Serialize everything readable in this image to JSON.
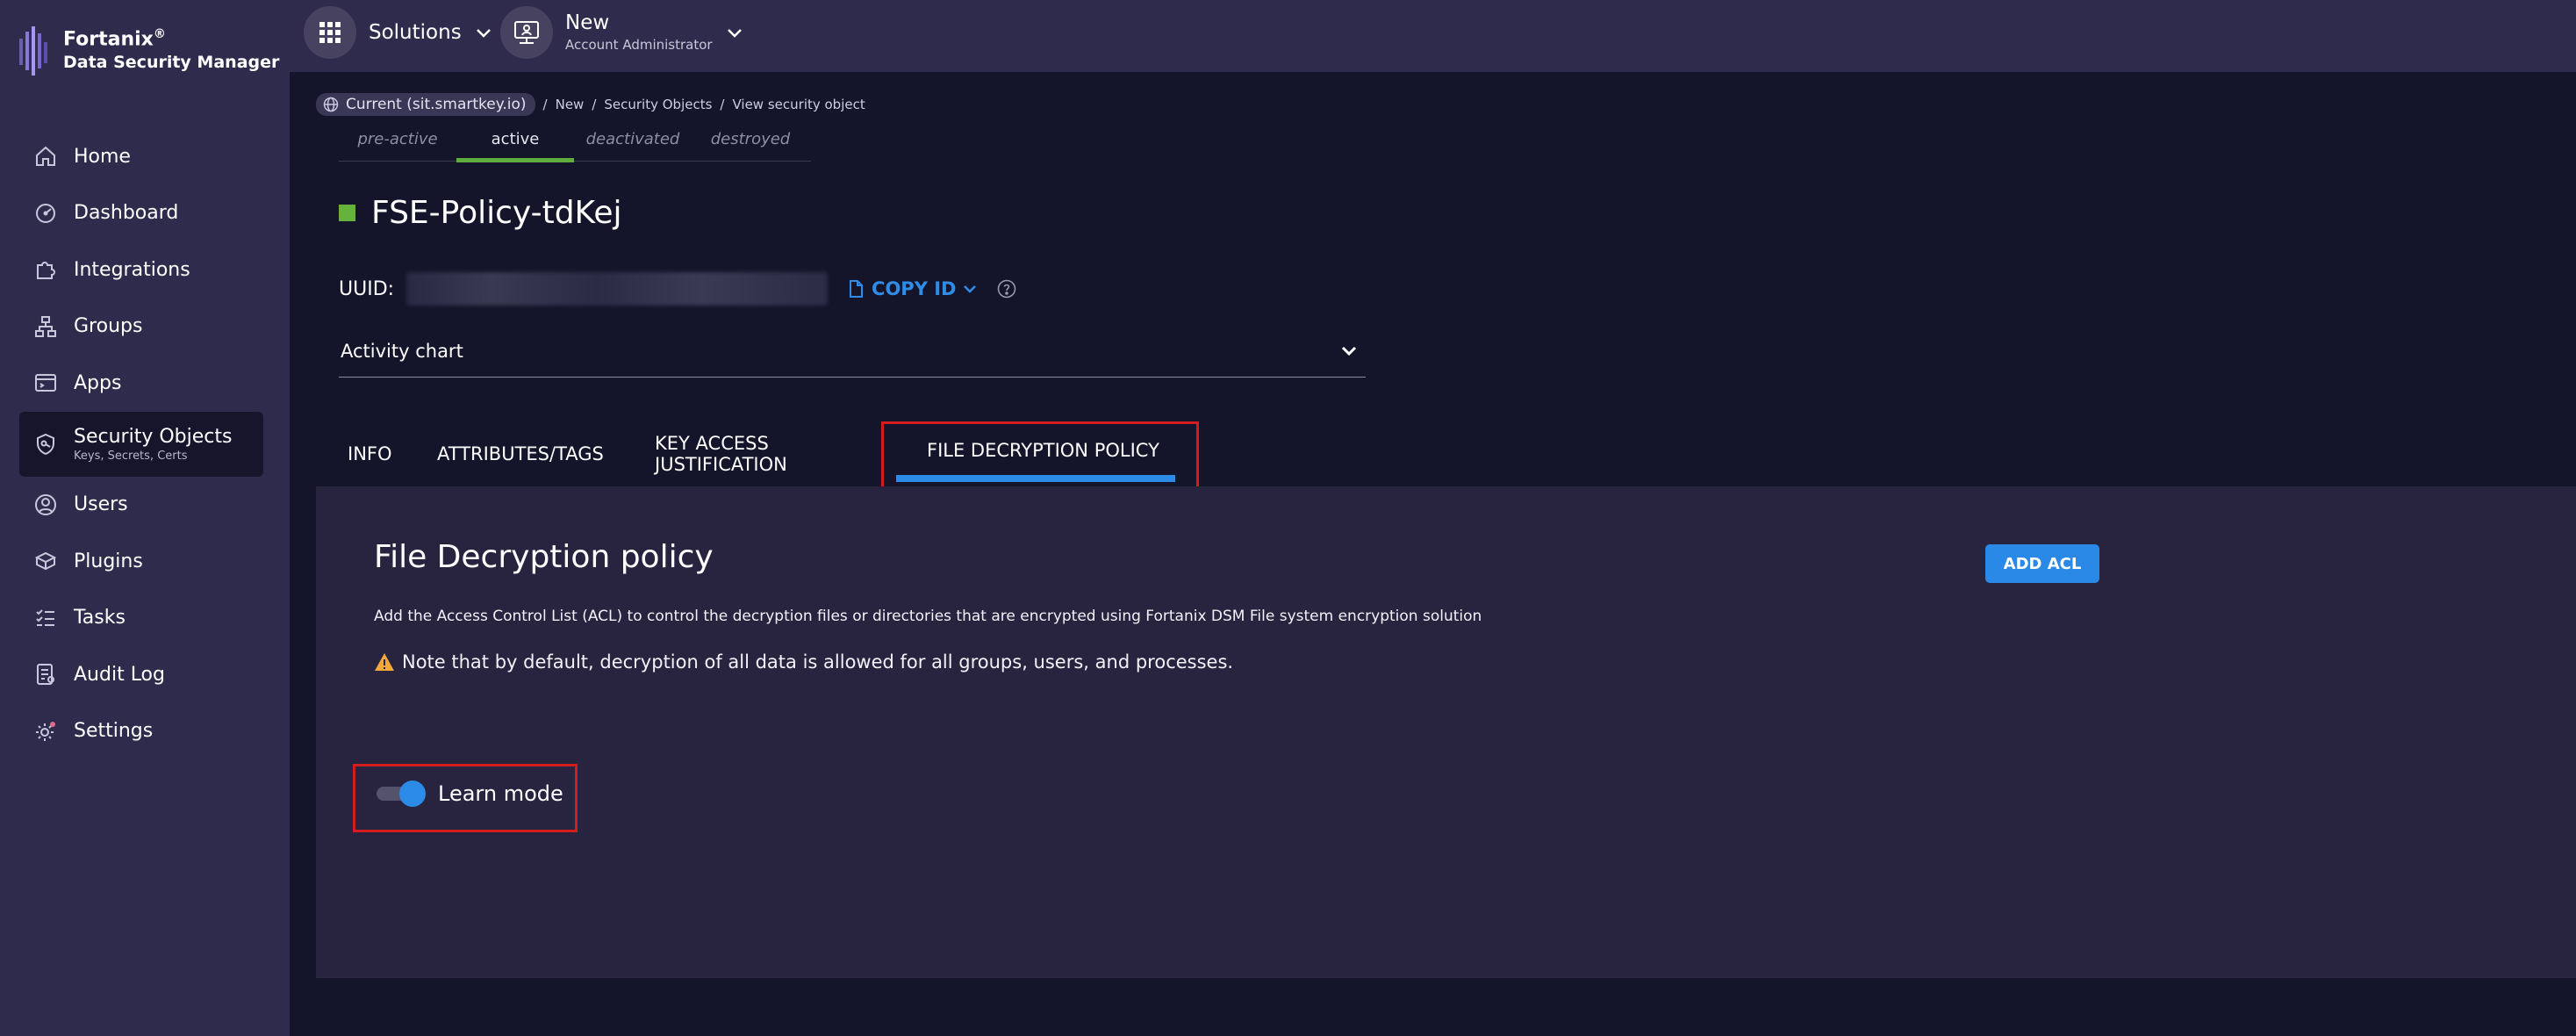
{
  "brand": {
    "name": "Fortanix",
    "registered": "®",
    "product": "Data Security Manager"
  },
  "nav": {
    "items": [
      {
        "label": "Home",
        "icon": "home-icon"
      },
      {
        "label": "Dashboard",
        "icon": "dashboard-icon"
      },
      {
        "label": "Integrations",
        "icon": "puzzle-icon"
      },
      {
        "label": "Groups",
        "icon": "groups-icon"
      },
      {
        "label": "Apps",
        "icon": "apps-icon"
      },
      {
        "label": "Security Objects",
        "sub": "Keys, Secrets, Certs",
        "icon": "shield-key-icon",
        "active": true
      },
      {
        "label": "Users",
        "icon": "user-icon"
      },
      {
        "label": "Plugins",
        "icon": "plugin-icon"
      },
      {
        "label": "Tasks",
        "icon": "tasks-icon"
      },
      {
        "label": "Audit Log",
        "icon": "audit-log-icon"
      },
      {
        "label": "Settings",
        "icon": "gear-icon"
      }
    ]
  },
  "topbar": {
    "solutions_label": "Solutions",
    "account_name": "New",
    "account_role": "Account Administrator"
  },
  "breadcrumb": {
    "current": "Current (sit.smartkey.io)",
    "items": [
      "New",
      "Security Objects",
      "View security object"
    ],
    "separator": "/"
  },
  "states": {
    "items": [
      "pre-active",
      "active",
      "deactivated",
      "destroyed"
    ],
    "active": "active"
  },
  "object": {
    "title": "FSE-Policy-tdKej",
    "status_color": "#65b33d",
    "uuid_label": "UUID:",
    "uuid_value": "••••••••-••••-••••-••••-••••••••••••",
    "copy_label": "COPY ID"
  },
  "activity": {
    "label": "Activity chart"
  },
  "tabs": {
    "items": [
      "INFO",
      "ATTRIBUTES/TAGS",
      "KEY ACCESS JUSTIFICATION",
      "FILE DECRYPTION POLICY"
    ],
    "active": "FILE DECRYPTION POLICY"
  },
  "panel": {
    "title": "File Decryption policy",
    "add_acl_label": "ADD ACL",
    "description": "Add the Access Control List (ACL) to control the decryption files or directories that are encrypted using Fortanix DSM File system encryption solution",
    "note": "Note that by default, decryption of all data is allowed for all groups, users, and processes.",
    "learn_mode_label": "Learn mode",
    "learn_mode_on": true
  },
  "colors": {
    "accent": "#2b8be6",
    "highlight": "#d31d1d",
    "active_state": "#5fad3f",
    "warning": "#f2a93b"
  }
}
